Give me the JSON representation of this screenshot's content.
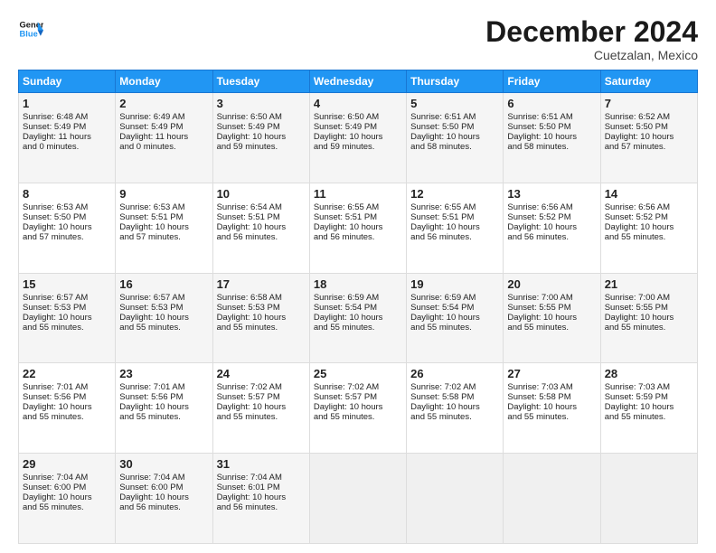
{
  "header": {
    "logo_general": "General",
    "logo_blue": "Blue",
    "month": "December 2024",
    "location": "Cuetzalan, Mexico"
  },
  "days_of_week": [
    "Sunday",
    "Monday",
    "Tuesday",
    "Wednesday",
    "Thursday",
    "Friday",
    "Saturday"
  ],
  "weeks": [
    [
      {
        "day": "1",
        "lines": [
          "Sunrise: 6:48 AM",
          "Sunset: 5:49 PM",
          "Daylight: 11 hours",
          "and 0 minutes."
        ]
      },
      {
        "day": "2",
        "lines": [
          "Sunrise: 6:49 AM",
          "Sunset: 5:49 PM",
          "Daylight: 11 hours",
          "and 0 minutes."
        ]
      },
      {
        "day": "3",
        "lines": [
          "Sunrise: 6:50 AM",
          "Sunset: 5:49 PM",
          "Daylight: 10 hours",
          "and 59 minutes."
        ]
      },
      {
        "day": "4",
        "lines": [
          "Sunrise: 6:50 AM",
          "Sunset: 5:49 PM",
          "Daylight: 10 hours",
          "and 59 minutes."
        ]
      },
      {
        "day": "5",
        "lines": [
          "Sunrise: 6:51 AM",
          "Sunset: 5:50 PM",
          "Daylight: 10 hours",
          "and 58 minutes."
        ]
      },
      {
        "day": "6",
        "lines": [
          "Sunrise: 6:51 AM",
          "Sunset: 5:50 PM",
          "Daylight: 10 hours",
          "and 58 minutes."
        ]
      },
      {
        "day": "7",
        "lines": [
          "Sunrise: 6:52 AM",
          "Sunset: 5:50 PM",
          "Daylight: 10 hours",
          "and 57 minutes."
        ]
      }
    ],
    [
      {
        "day": "8",
        "lines": [
          "Sunrise: 6:53 AM",
          "Sunset: 5:50 PM",
          "Daylight: 10 hours",
          "and 57 minutes."
        ]
      },
      {
        "day": "9",
        "lines": [
          "Sunrise: 6:53 AM",
          "Sunset: 5:51 PM",
          "Daylight: 10 hours",
          "and 57 minutes."
        ]
      },
      {
        "day": "10",
        "lines": [
          "Sunrise: 6:54 AM",
          "Sunset: 5:51 PM",
          "Daylight: 10 hours",
          "and 56 minutes."
        ]
      },
      {
        "day": "11",
        "lines": [
          "Sunrise: 6:55 AM",
          "Sunset: 5:51 PM",
          "Daylight: 10 hours",
          "and 56 minutes."
        ]
      },
      {
        "day": "12",
        "lines": [
          "Sunrise: 6:55 AM",
          "Sunset: 5:51 PM",
          "Daylight: 10 hours",
          "and 56 minutes."
        ]
      },
      {
        "day": "13",
        "lines": [
          "Sunrise: 6:56 AM",
          "Sunset: 5:52 PM",
          "Daylight: 10 hours",
          "and 56 minutes."
        ]
      },
      {
        "day": "14",
        "lines": [
          "Sunrise: 6:56 AM",
          "Sunset: 5:52 PM",
          "Daylight: 10 hours",
          "and 55 minutes."
        ]
      }
    ],
    [
      {
        "day": "15",
        "lines": [
          "Sunrise: 6:57 AM",
          "Sunset: 5:53 PM",
          "Daylight: 10 hours",
          "and 55 minutes."
        ]
      },
      {
        "day": "16",
        "lines": [
          "Sunrise: 6:57 AM",
          "Sunset: 5:53 PM",
          "Daylight: 10 hours",
          "and 55 minutes."
        ]
      },
      {
        "day": "17",
        "lines": [
          "Sunrise: 6:58 AM",
          "Sunset: 5:53 PM",
          "Daylight: 10 hours",
          "and 55 minutes."
        ]
      },
      {
        "day": "18",
        "lines": [
          "Sunrise: 6:59 AM",
          "Sunset: 5:54 PM",
          "Daylight: 10 hours",
          "and 55 minutes."
        ]
      },
      {
        "day": "19",
        "lines": [
          "Sunrise: 6:59 AM",
          "Sunset: 5:54 PM",
          "Daylight: 10 hours",
          "and 55 minutes."
        ]
      },
      {
        "day": "20",
        "lines": [
          "Sunrise: 7:00 AM",
          "Sunset: 5:55 PM",
          "Daylight: 10 hours",
          "and 55 minutes."
        ]
      },
      {
        "day": "21",
        "lines": [
          "Sunrise: 7:00 AM",
          "Sunset: 5:55 PM",
          "Daylight: 10 hours",
          "and 55 minutes."
        ]
      }
    ],
    [
      {
        "day": "22",
        "lines": [
          "Sunrise: 7:01 AM",
          "Sunset: 5:56 PM",
          "Daylight: 10 hours",
          "and 55 minutes."
        ]
      },
      {
        "day": "23",
        "lines": [
          "Sunrise: 7:01 AM",
          "Sunset: 5:56 PM",
          "Daylight: 10 hours",
          "and 55 minutes."
        ]
      },
      {
        "day": "24",
        "lines": [
          "Sunrise: 7:02 AM",
          "Sunset: 5:57 PM",
          "Daylight: 10 hours",
          "and 55 minutes."
        ]
      },
      {
        "day": "25",
        "lines": [
          "Sunrise: 7:02 AM",
          "Sunset: 5:57 PM",
          "Daylight: 10 hours",
          "and 55 minutes."
        ]
      },
      {
        "day": "26",
        "lines": [
          "Sunrise: 7:02 AM",
          "Sunset: 5:58 PM",
          "Daylight: 10 hours",
          "and 55 minutes."
        ]
      },
      {
        "day": "27",
        "lines": [
          "Sunrise: 7:03 AM",
          "Sunset: 5:58 PM",
          "Daylight: 10 hours",
          "and 55 minutes."
        ]
      },
      {
        "day": "28",
        "lines": [
          "Sunrise: 7:03 AM",
          "Sunset: 5:59 PM",
          "Daylight: 10 hours",
          "and 55 minutes."
        ]
      }
    ],
    [
      {
        "day": "29",
        "lines": [
          "Sunrise: 7:04 AM",
          "Sunset: 6:00 PM",
          "Daylight: 10 hours",
          "and 55 minutes."
        ]
      },
      {
        "day": "30",
        "lines": [
          "Sunrise: 7:04 AM",
          "Sunset: 6:00 PM",
          "Daylight: 10 hours",
          "and 56 minutes."
        ]
      },
      {
        "day": "31",
        "lines": [
          "Sunrise: 7:04 AM",
          "Sunset: 6:01 PM",
          "Daylight: 10 hours",
          "and 56 minutes."
        ]
      },
      {
        "day": "",
        "lines": []
      },
      {
        "day": "",
        "lines": []
      },
      {
        "day": "",
        "lines": []
      },
      {
        "day": "",
        "lines": []
      }
    ]
  ]
}
